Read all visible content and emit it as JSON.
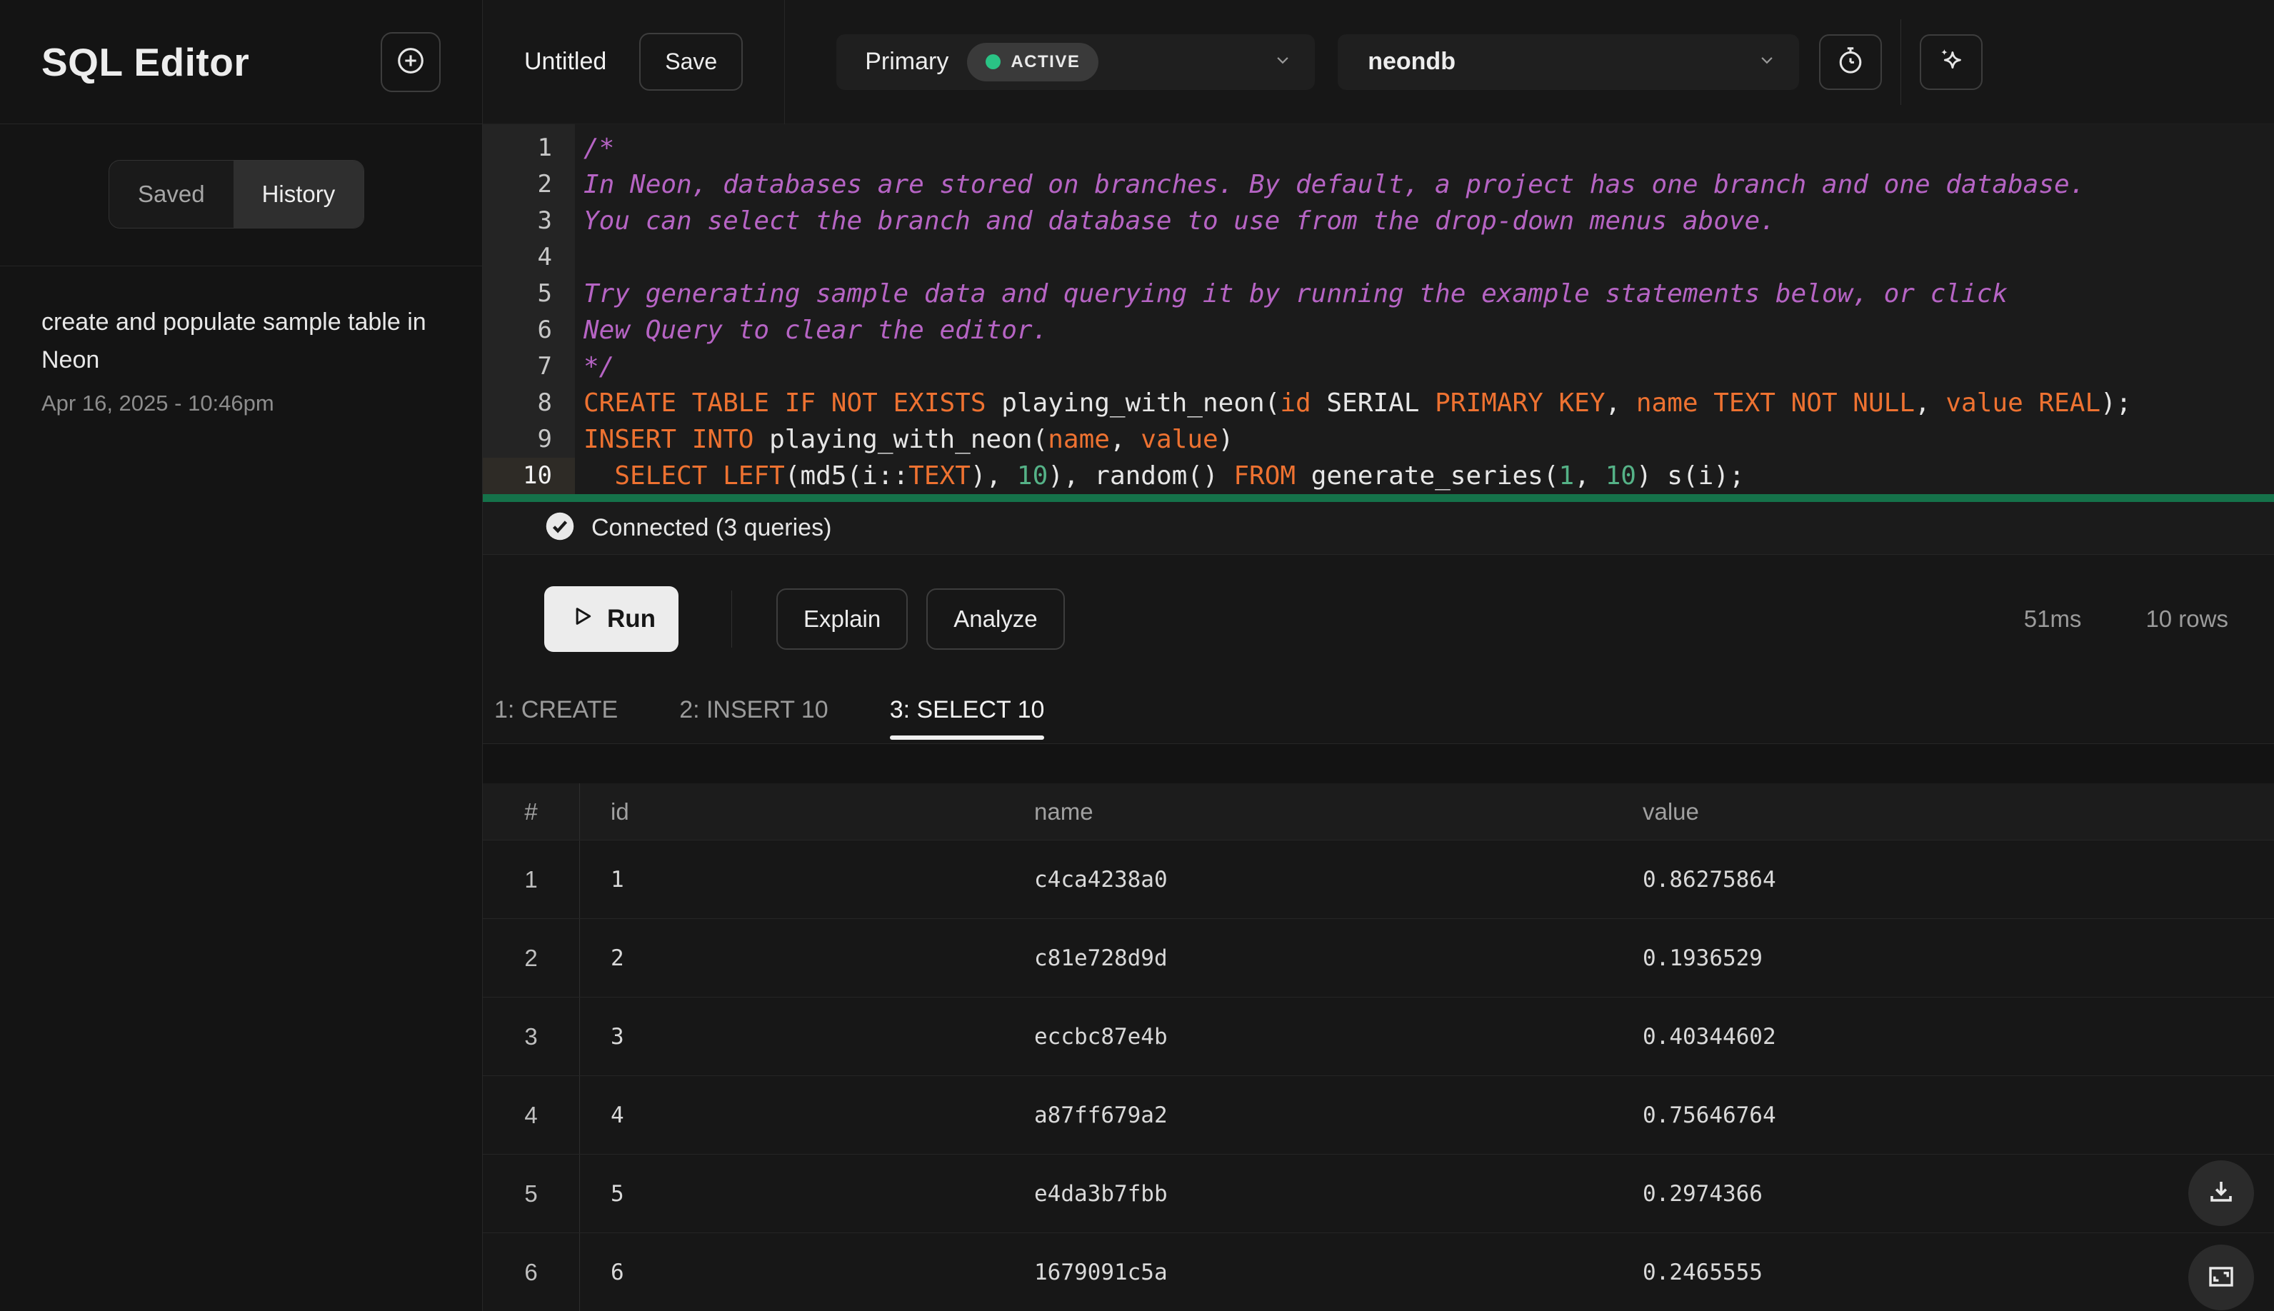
{
  "app": {
    "title": "SQL Editor"
  },
  "sidebar": {
    "tabs": [
      {
        "label": "Saved",
        "active": false
      },
      {
        "label": "History",
        "active": true
      }
    ],
    "history": [
      {
        "title": "create and populate sample table in Neon",
        "timestamp": "Apr 16, 2025 - 10:46pm"
      }
    ]
  },
  "topbar": {
    "tab_title": "Untitled",
    "save_label": "Save",
    "branch": {
      "name": "Primary",
      "status": "ACTIVE"
    },
    "database": {
      "name": "neondb"
    }
  },
  "editor": {
    "active_line": 10,
    "lines": [
      [
        {
          "t": "com",
          "s": "/*"
        }
      ],
      [
        {
          "t": "com",
          "s": "In Neon, databases are stored on branches. By default, a project has one branch and one database."
        }
      ],
      [
        {
          "t": "com",
          "s": "You can select the branch and database to use from the drop-down menus above."
        }
      ],
      [],
      [
        {
          "t": "com",
          "s": "Try generating sample data and querying it by running the example statements below, or click"
        }
      ],
      [
        {
          "t": "com",
          "s": "New Query to clear the editor."
        }
      ],
      [
        {
          "t": "com",
          "s": "*/"
        }
      ],
      [
        {
          "t": "kw",
          "s": "CREATE TABLE IF NOT EXISTS"
        },
        {
          "t": "pl",
          "s": " playing_with_neon("
        },
        {
          "t": "kw",
          "s": "id"
        },
        {
          "t": "pl",
          "s": " SERIAL "
        },
        {
          "t": "kw",
          "s": "PRIMARY KEY"
        },
        {
          "t": "pl",
          "s": ", "
        },
        {
          "t": "kw",
          "s": "name TEXT NOT NULL"
        },
        {
          "t": "pl",
          "s": ", "
        },
        {
          "t": "kw",
          "s": "value REAL"
        },
        {
          "t": "pl",
          "s": ");"
        }
      ],
      [
        {
          "t": "kw",
          "s": "INSERT INTO"
        },
        {
          "t": "pl",
          "s": " playing_with_neon("
        },
        {
          "t": "kw",
          "s": "name"
        },
        {
          "t": "pl",
          "s": ", "
        },
        {
          "t": "kw",
          "s": "value"
        },
        {
          "t": "pl",
          "s": ")"
        }
      ],
      [
        {
          "t": "pl",
          "s": "  "
        },
        {
          "t": "kw",
          "s": "SELECT LEFT"
        },
        {
          "t": "pl",
          "s": "(md5(i::"
        },
        {
          "t": "kw",
          "s": "TEXT"
        },
        {
          "t": "pl",
          "s": "), "
        },
        {
          "t": "num",
          "s": "10"
        },
        {
          "t": "pl",
          "s": "), random() "
        },
        {
          "t": "kw",
          "s": "FROM"
        },
        {
          "t": "pl",
          "s": " generate_series("
        },
        {
          "t": "num",
          "s": "1"
        },
        {
          "t": "pl",
          "s": ", "
        },
        {
          "t": "num",
          "s": "10"
        },
        {
          "t": "pl",
          "s": ") s(i);"
        }
      ]
    ]
  },
  "status": {
    "text": "Connected (3 queries)"
  },
  "actions": {
    "run_label": "Run",
    "explain_label": "Explain",
    "analyze_label": "Analyze",
    "duration": "51ms",
    "row_count": "10 rows"
  },
  "result_tabs": [
    {
      "label": "1: CREATE",
      "active": false
    },
    {
      "label": "2: INSERT 10",
      "active": false
    },
    {
      "label": "3: SELECT 10",
      "active": true
    }
  ],
  "table": {
    "columns": [
      "#",
      "id",
      "name",
      "value"
    ],
    "rows": [
      {
        "num": "1",
        "id": "1",
        "name": "c4ca4238a0",
        "value": "0.86275864"
      },
      {
        "num": "2",
        "id": "2",
        "name": "c81e728d9d",
        "value": "0.1936529"
      },
      {
        "num": "3",
        "id": "3",
        "name": "eccbc87e4b",
        "value": "0.40344602"
      },
      {
        "num": "4",
        "id": "4",
        "name": "a87ff679a2",
        "value": "0.75646764"
      },
      {
        "num": "5",
        "id": "5",
        "name": "e4da3b7fbb",
        "value": "0.2974366"
      },
      {
        "num": "6",
        "id": "6",
        "name": "1679091c5a",
        "value": "0.2465555"
      }
    ]
  },
  "colors": {
    "status_green": "#2ac385",
    "keyword_orange": "#ee7231",
    "comment_purple": "#b664c4",
    "number_green": "#55b287",
    "active_query_bar": "#15724a"
  }
}
